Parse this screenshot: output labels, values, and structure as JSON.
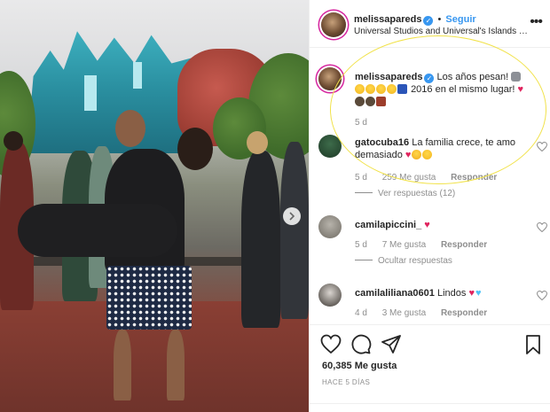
{
  "post": {
    "author": "melissapareds",
    "follow_label": "Seguir",
    "location": "Universal Studios and Universal's Islands of Ad…"
  },
  "comments": [
    {
      "username": "melissapareds",
      "verified": true,
      "text_1": "Los años pesan!",
      "text_2": "2016 en el mismo lugar!",
      "time": "5 d"
    },
    {
      "username": "gatocuba16",
      "text": "La familia crece, te amo demasiado",
      "time": "5 d",
      "likes": "259 Me gusta",
      "reply": "Responder",
      "view_replies": "Ver respuestas (12)"
    },
    {
      "username": "camilapiccini_",
      "text": "",
      "time": "5 d",
      "likes": "7 Me gusta",
      "reply": "Responder",
      "hide_replies": "Ocultar respuestas"
    },
    {
      "username": "camilaliliana0601",
      "text": "Lindos",
      "time": "4 d",
      "likes": "3 Me gusta",
      "reply": "Responder"
    }
  ],
  "footer": {
    "likes": "60,385 Me gusta",
    "ago": "HACE 5 DÍAS"
  },
  "colors": {
    "link": "#3897f0",
    "muted": "#8e8e8e",
    "highlight_ellipse": "#f1e24a",
    "heart": "#e0245e"
  },
  "icons": [
    "more-icon",
    "heart-icon",
    "comment-icon",
    "share-icon",
    "bookmark-icon",
    "verified-icon",
    "next-arrow-icon"
  ]
}
